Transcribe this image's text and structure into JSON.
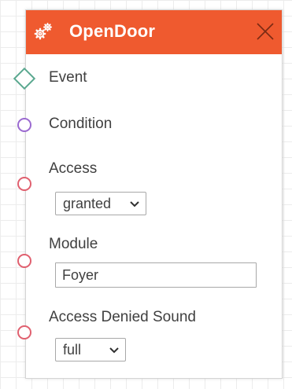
{
  "node": {
    "title": "OpenDoor",
    "header_icon": "gears-icon",
    "close_icon": "close-icon",
    "header_color": "#ef5a2f"
  },
  "ports": {
    "event": {
      "label": "Event",
      "color": "#5aa88f",
      "shape": "diamond"
    },
    "condition": {
      "label": "Condition",
      "color": "#9b6ad0",
      "shape": "circle"
    },
    "access": {
      "label": "Access",
      "color": "#e0606f",
      "shape": "circle"
    },
    "module": {
      "label": "Module",
      "color": "#e0606f",
      "shape": "circle"
    },
    "access_denied_sound": {
      "label": "Access Denied Sound",
      "color": "#e0606f",
      "shape": "circle"
    }
  },
  "fields": {
    "access_select": {
      "value": "granted"
    },
    "module_input": {
      "value": "Foyer"
    },
    "sound_select": {
      "value": "full"
    }
  }
}
